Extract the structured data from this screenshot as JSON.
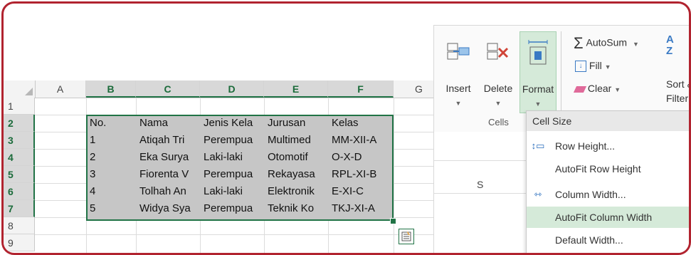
{
  "sheet": {
    "columns": [
      "A",
      "B",
      "C",
      "D",
      "E",
      "F",
      "G"
    ],
    "rows": [
      "1",
      "2",
      "3",
      "4",
      "5",
      "6",
      "7",
      "8",
      "9"
    ],
    "table": [
      [
        "No.",
        "Nama",
        "Jenis Kela",
        "Jurusan",
        "Kelas"
      ],
      [
        "1",
        "Atiqah Tri",
        "Perempua",
        "Multimed",
        "MM-XII-A"
      ],
      [
        "2",
        "Eka Surya",
        "Laki-laki",
        "Otomotif",
        "O-X-D"
      ],
      [
        "3",
        "Fiorenta V",
        "Perempua",
        "Rekayasa",
        "RPL-XI-B"
      ],
      [
        "4",
        "Tolhah An",
        "Laki-laki",
        "Elektronik",
        "E-XI-C"
      ],
      [
        "5",
        "Widya Sya",
        "Perempua",
        "Teknik Ko",
        "TKJ-XI-A"
      ]
    ],
    "lower_col_label": "S"
  },
  "ribbon": {
    "insert_label": "Insert",
    "delete_label": "Delete",
    "format_label": "Format",
    "cells_group": "Cells",
    "autosum_label": "AutoSum",
    "fill_label": "Fill",
    "clear_label": "Clear",
    "sort_label": "Sort &",
    "filter_label": "Filter"
  },
  "menu": {
    "header": "Cell Size",
    "items": [
      "Row Height...",
      "AutoFit Row Height",
      "Column Width...",
      "AutoFit Column Width",
      "Default Width..."
    ]
  },
  "colors": {
    "frame": "#b1232f",
    "selection": "#217346",
    "highlight": "#d5ead9",
    "selected_fill": "#c6c6c6"
  }
}
